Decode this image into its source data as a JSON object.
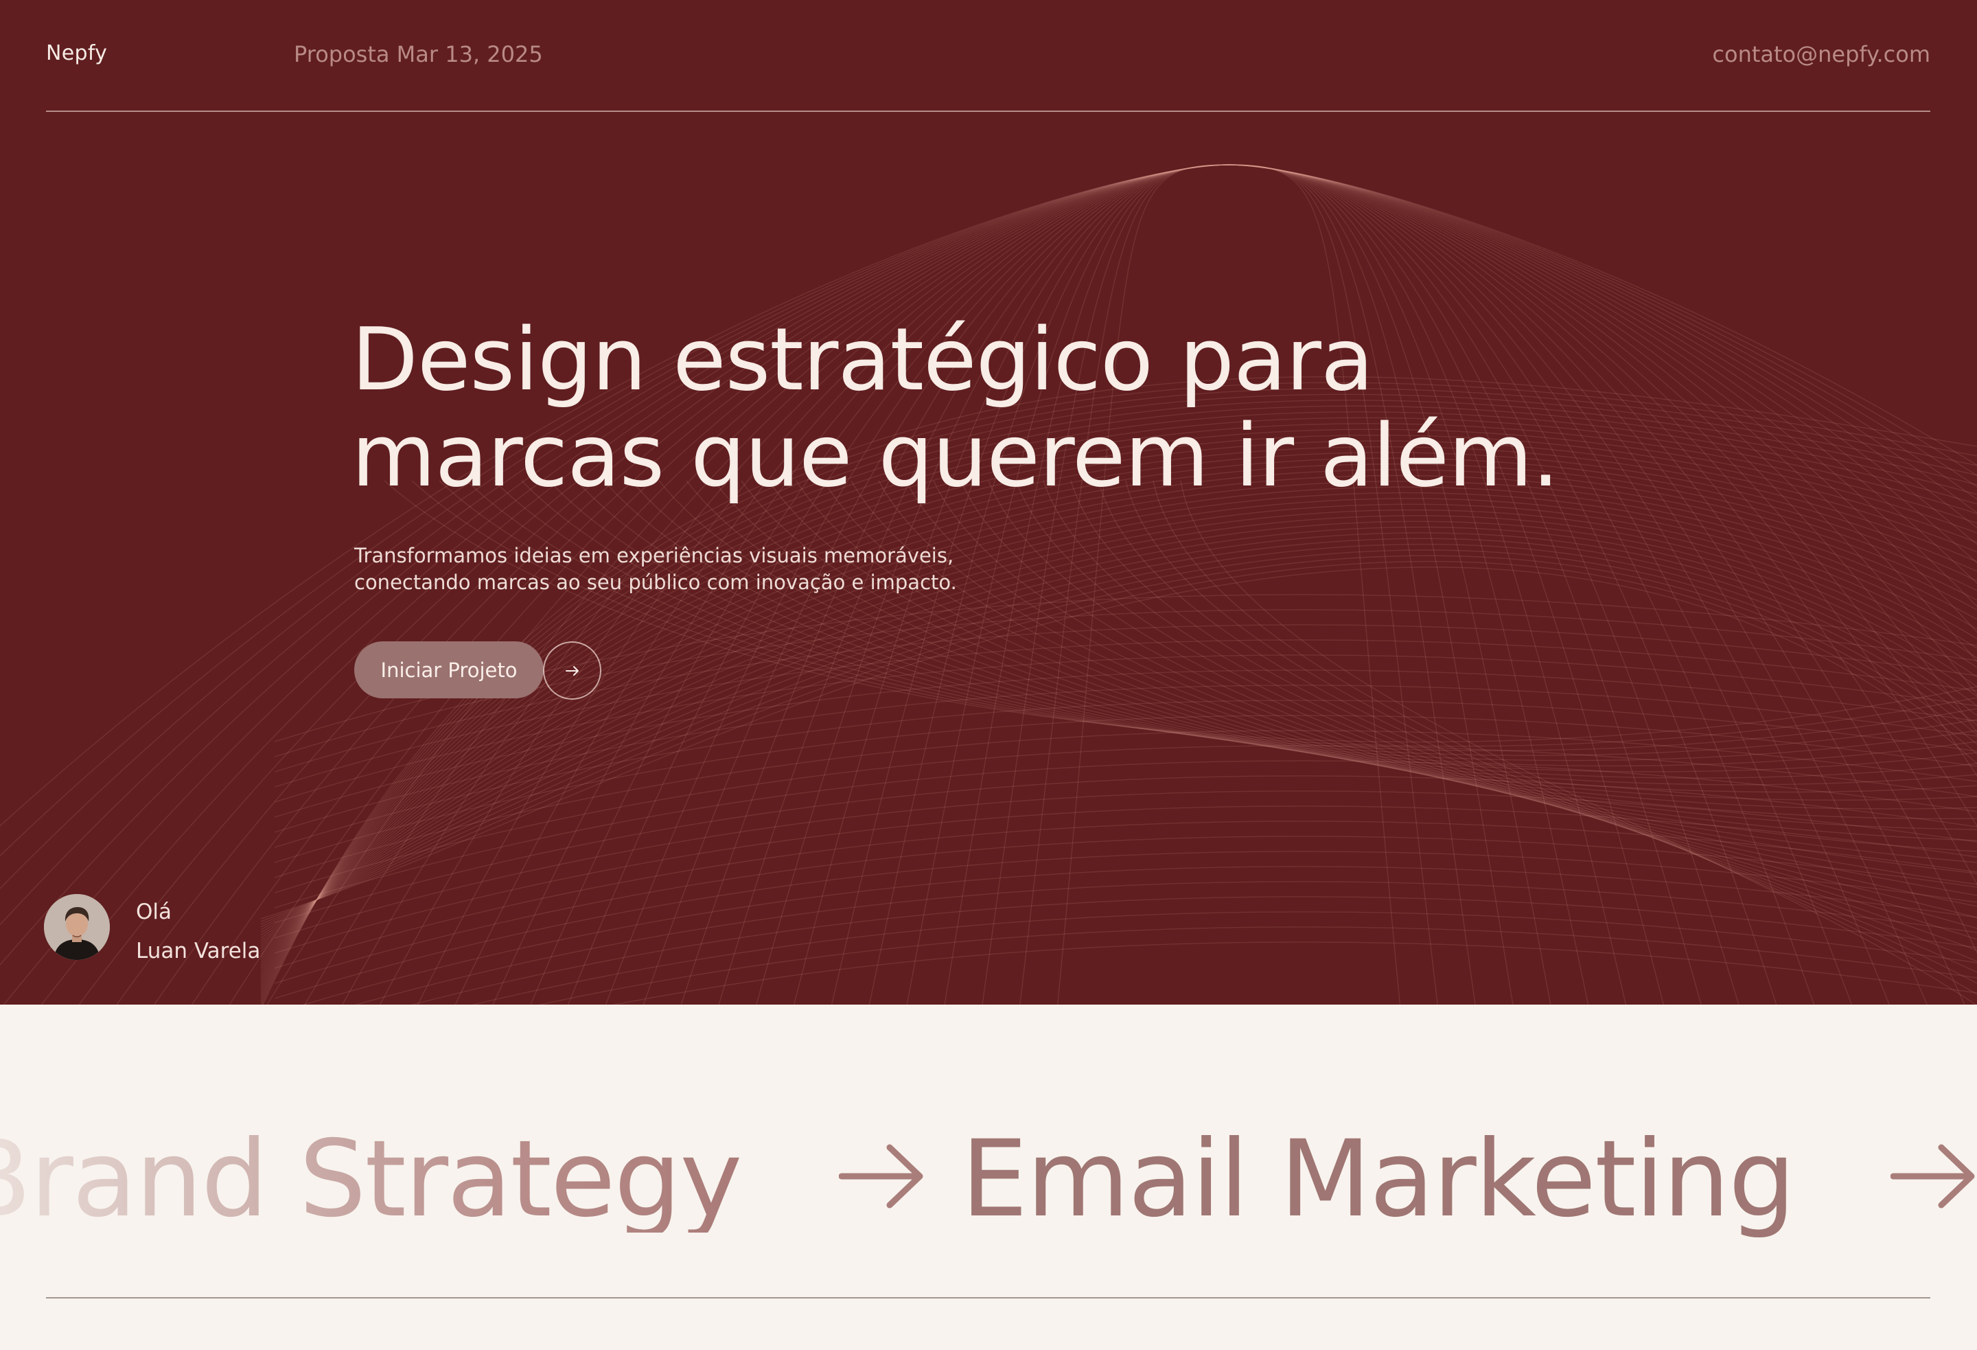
{
  "header": {
    "brand": "Nepfy",
    "proposal_date": "Proposta Mar 13, 2025",
    "contact_email": "contato@nepfy.com"
  },
  "hero": {
    "headline_line1": "Design estratégico para",
    "headline_line2": "marcas que querem ir além.",
    "subtext_line1": "Transformamos ideias em experiências visuais memoráveis,",
    "subtext_line2": "conectando marcas ao seu público com inovação e impacto.",
    "cta_label": "Iniciar Projeto",
    "cta_icon": "arrow-right-icon"
  },
  "user": {
    "greeting": "Olá",
    "name": "Luan Varela"
  },
  "ticker": {
    "items": [
      "Brand Strategy",
      "Email Marketing"
    ],
    "separator_icon": "arrow-right-icon"
  },
  "colors": {
    "hero_background": "#601e20",
    "page_background": "#f8f3ee",
    "ticker_text": "#9f7673",
    "cta_background": "#9a7270"
  }
}
